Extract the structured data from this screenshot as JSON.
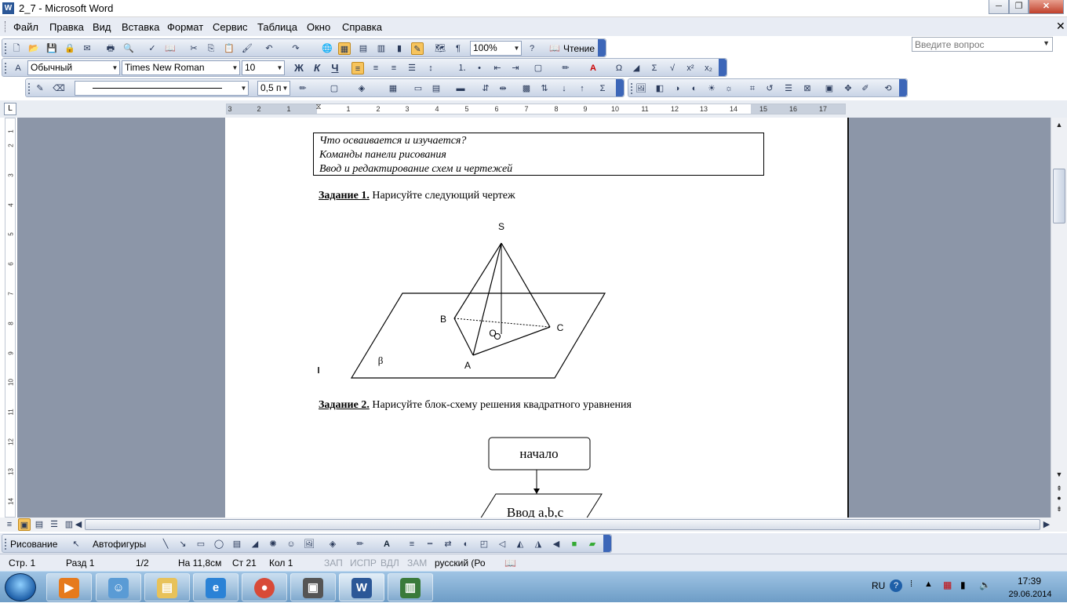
{
  "window": {
    "title": "2_7 - Microsoft Word",
    "app_icon": "W"
  },
  "menu": {
    "items": [
      "Файл",
      "Правка",
      "Вид",
      "Вставка",
      "Формат",
      "Сервис",
      "Таблица",
      "Окно",
      "Справка"
    ],
    "ask_placeholder": "Введите вопрос"
  },
  "toolbar_standard": {
    "zoom": "100%",
    "reading_label": "Чтение"
  },
  "toolbar_format": {
    "style": "Обычный",
    "font": "Times New Roman",
    "size": "10",
    "bold": "Ж",
    "italic": "К",
    "underline": "Ч"
  },
  "toolbar_borders": {
    "line_weight": "0,5 п"
  },
  "ruler": {
    "h_labels": [
      "3",
      "2",
      "1",
      "1",
      "2",
      "3",
      "4",
      "5",
      "6",
      "7",
      "8",
      "9",
      "10",
      "11",
      "12",
      "13",
      "14",
      "15",
      "16",
      "17"
    ],
    "v_labels": [
      "1",
      "2",
      "3",
      "4",
      "5",
      "6",
      "7",
      "8",
      "9",
      "10",
      "11",
      "12",
      "13",
      "14"
    ]
  },
  "document": {
    "info_lines": [
      "Что осваивается и изучается?",
      "Команды панели рисования",
      "Ввод и редактирование схем и чертежей"
    ],
    "task1_label": "Задание 1.",
    "task1_text": " Нарисуйте следующий чертеж",
    "task2_label": "Задание 2.",
    "task2_text": " Нарисуйте блок-схему решения квадратного уравнения",
    "pyramid_labels": {
      "s": "S",
      "b": "B",
      "c": "C",
      "o": "O",
      "a": "A",
      "beta": "β"
    },
    "flow_start": "начало",
    "flow_input": "Ввод  a,b,c"
  },
  "drawing_toolbar": {
    "draw_label": "Рисование",
    "autoshapes_label": "Автофигуры"
  },
  "status": {
    "page": "Стр. 1",
    "section": "Разд  1",
    "pages": "1/2",
    "at": "На  11,8см",
    "line": "Ст  21",
    "col": "Кол  1",
    "rec": "ЗАП",
    "trk": "ИСПР",
    "ext": "ВДЛ",
    "ovr": "ЗАМ",
    "lang": "русский (Ро"
  },
  "taskbar": {
    "lang": "RU",
    "time": "17:39",
    "date": "29.06.2014",
    "apps": [
      "media-player",
      "people",
      "explorer",
      "internet-explorer",
      "chrome",
      "remote-desktop",
      "word",
      "monitor"
    ]
  }
}
